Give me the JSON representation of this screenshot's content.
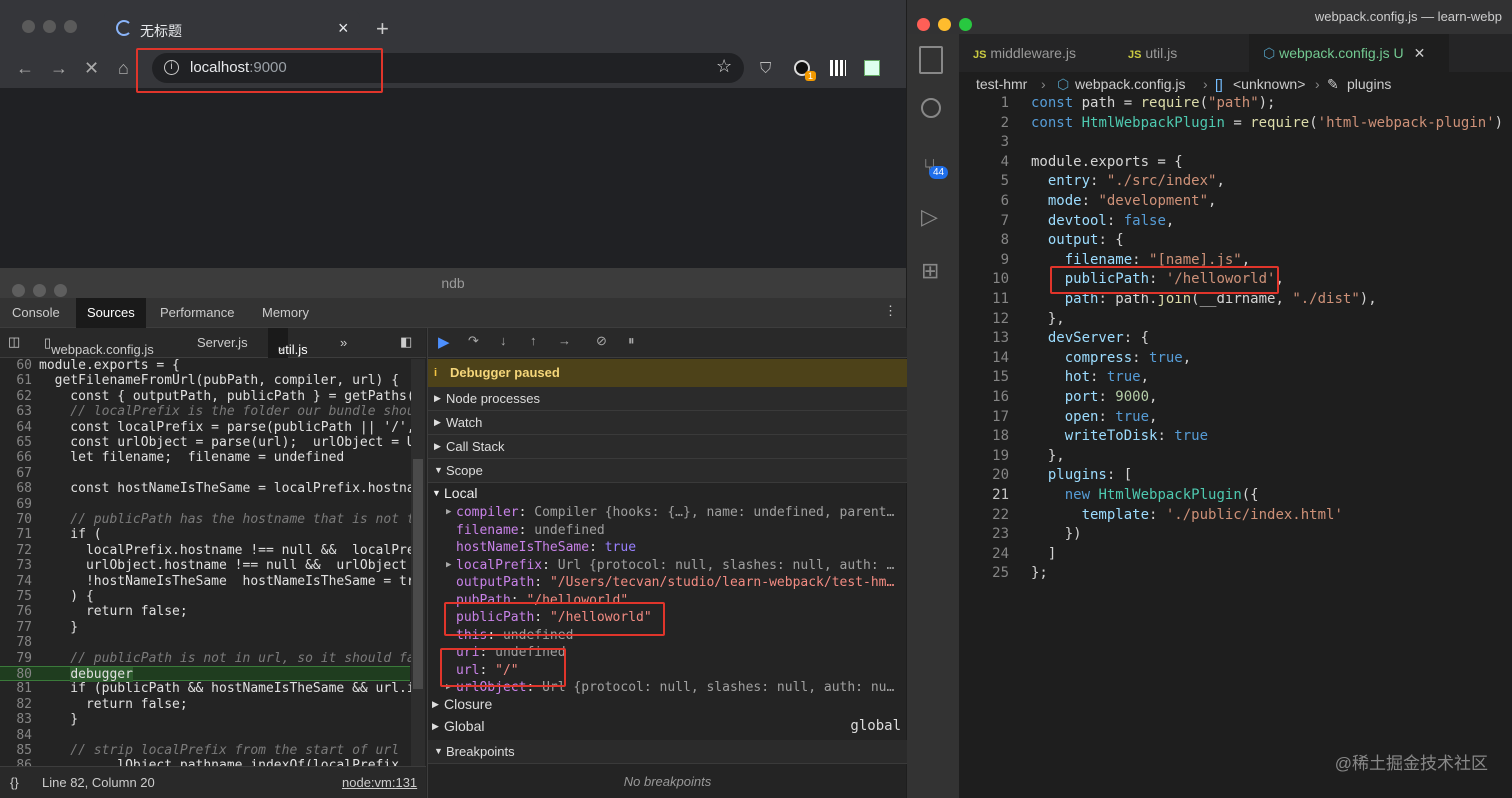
{
  "browser": {
    "tab_title": "无标题",
    "url_host": "localhost",
    "url_port": ":9000",
    "new_tab": "+",
    "close_tab": "×",
    "extension_badge": "1"
  },
  "ndb": {
    "title": "ndb",
    "tabs": [
      "Console",
      "Sources",
      "Performance",
      "Memory"
    ],
    "file_tabs": [
      "webpack.config.js",
      "Server.js",
      "util.js"
    ],
    "code_lines": [
      {
        "n": "60",
        "t": "module.exports = {"
      },
      {
        "n": "61",
        "t": "  getFilenameFromUrl(pubPath, compiler, url) {  p"
      },
      {
        "n": "62",
        "t": "    const { outputPath, publicPath } = getPaths(p"
      },
      {
        "n": "63",
        "t": "    // localPrefix is the folder our bundle shoul"
      },
      {
        "n": "64",
        "t": "    const localPrefix = parse(publicPath || '/',"
      },
      {
        "n": "65",
        "t": "    const urlObject = parse(url);  urlObject = Ur"
      },
      {
        "n": "66",
        "t": "    let filename;  filename = undefined"
      },
      {
        "n": "67",
        "t": ""
      },
      {
        "n": "68",
        "t": "    const hostNameIsTheSame = localPrefix.hostna"
      },
      {
        "n": "69",
        "t": ""
      },
      {
        "n": "70",
        "t": "    // publicPath has the hostname that is not th"
      },
      {
        "n": "71",
        "t": "    if ("
      },
      {
        "n": "72",
        "t": "      localPrefix.hostname !== null &&  localPref"
      },
      {
        "n": "73",
        "t": "      urlObject.hostname !== null &&  urlObject ="
      },
      {
        "n": "74",
        "t": "      !hostNameIsTheSame  hostNameIsTheSame = tru"
      },
      {
        "n": "75",
        "t": "    ) {"
      },
      {
        "n": "76",
        "t": "      return false;"
      },
      {
        "n": "77",
        "t": "    }"
      },
      {
        "n": "78",
        "t": ""
      },
      {
        "n": "79",
        "t": "    // publicPath is not in url, so it should fai"
      },
      {
        "n": "80",
        "t": "    debugger"
      },
      {
        "n": "81",
        "t": "    if (publicPath && hostNameIsTheSame && url.in"
      },
      {
        "n": "82",
        "t": "      return false;"
      },
      {
        "n": "83",
        "t": "    }"
      },
      {
        "n": "84",
        "t": ""
      },
      {
        "n": "85",
        "t": "    // strip localPrefix from the start of url"
      },
      {
        "n": "86",
        "t": "          lObject.pathname.indexOf(localPrefix."
      }
    ],
    "status_position": "Line 82, Column 20",
    "status_source": "node:vm:131",
    "paused_label": "Debugger paused",
    "sections": [
      "Node processes",
      "Watch",
      "Call Stack",
      "Scope"
    ],
    "scope_local": "Local",
    "scope_vars": [
      {
        "k": "compiler",
        "v": "Compiler {hooks: {…}, name: undefined, parent…",
        "exp": true
      },
      {
        "k": "filename",
        "v": "undefined",
        "exp": false
      },
      {
        "k": "hostNameIsTheSame",
        "v": "true",
        "exp": false
      },
      {
        "k": "localPrefix",
        "v": "Url {protocol: null, slashes: null, auth: …",
        "exp": true
      },
      {
        "k": "outputPath",
        "v": "\"/Users/tecvan/studio/learn-webpack/test-hm…",
        "exp": false
      },
      {
        "k": "pubPath",
        "v": "\"/helloworld\"",
        "exp": false
      },
      {
        "k": "publicPath",
        "v": "\"/helloworld\"",
        "exp": false
      },
      {
        "k": "this",
        "v": "undefined",
        "exp": false
      },
      {
        "k": "uri",
        "v": "undefined",
        "exp": false
      },
      {
        "k": "url",
        "v": "\"/\"",
        "exp": false
      },
      {
        "k": "urlObject",
        "v": "Url {protocol: null, slashes: null, auth: nu…",
        "exp": true
      }
    ],
    "closure": "Closure",
    "global": "Global",
    "global_value": "global",
    "breakpoints": "Breakpoints",
    "no_breakpoints": "No breakpoints"
  },
  "vscode": {
    "title": "webpack.config.js — learn-webp",
    "tabs": [
      "middleware.js",
      "util.js",
      "webpack.config.js"
    ],
    "active_tab_status": "U",
    "js_badge": "JS",
    "scm_badge": "44",
    "breadcrumb": [
      "test-hmr",
      "webpack.config.js",
      "<unknown>",
      "plugins"
    ],
    "code_lines": [
      {
        "n": "1",
        "t": "const path = require(\"path\");"
      },
      {
        "n": "2",
        "t": "const HtmlWebpackPlugin = require('html-webpack-plugin')"
      },
      {
        "n": "3",
        "t": ""
      },
      {
        "n": "4",
        "t": "module.exports = {"
      },
      {
        "n": "5",
        "t": "  entry: \"./src/index\","
      },
      {
        "n": "6",
        "t": "  mode: \"development\","
      },
      {
        "n": "7",
        "t": "  devtool: false,"
      },
      {
        "n": "8",
        "t": "  output: {"
      },
      {
        "n": "9",
        "t": "    filename: \"[name].js\","
      },
      {
        "n": "10",
        "t": "    publicPath: '/helloworld',"
      },
      {
        "n": "11",
        "t": "    path: path.join(__dirname, \"./dist\"),"
      },
      {
        "n": "12",
        "t": "  },"
      },
      {
        "n": "13",
        "t": "  devServer: {"
      },
      {
        "n": "14",
        "t": "    compress: true,"
      },
      {
        "n": "15",
        "t": "    hot: true,"
      },
      {
        "n": "16",
        "t": "    port: 9000,"
      },
      {
        "n": "17",
        "t": "    open: true,"
      },
      {
        "n": "18",
        "t": "    writeToDisk: true"
      },
      {
        "n": "19",
        "t": "  },"
      },
      {
        "n": "20",
        "t": "  plugins: ["
      },
      {
        "n": "21",
        "t": "    new HtmlWebpackPlugin({"
      },
      {
        "n": "22",
        "t": "      template: './public/index.html'"
      },
      {
        "n": "23",
        "t": "    })"
      },
      {
        "n": "24",
        "t": "  ]"
      },
      {
        "n": "25",
        "t": "};"
      }
    ]
  },
  "watermark": "@稀土掘金技术社区",
  "colors": {
    "highlight_box": "#e0352b",
    "paused_bg": "#4d4219",
    "accent": "#4d90fe"
  }
}
